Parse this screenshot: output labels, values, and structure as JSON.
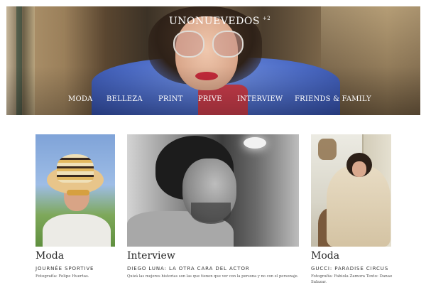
{
  "header": {
    "brand": "UNONUEVEDOS",
    "brand_suffix": "+2",
    "nav": [
      "MODA",
      "BELLEZA",
      "PRINT",
      "PRIVE",
      "INTERVIEW",
      "FRIENDS & FAMILY"
    ]
  },
  "cards": [
    {
      "category": "Moda",
      "title": "JOURNÉE SPORTIVE",
      "description": "Fotografía: Felipe Huertas."
    },
    {
      "category": "Interview",
      "title": "DIEGO LUNA: LA OTRA CARA DEL ACTOR",
      "description": "Quizá las mejores historias son las que tienen que ver con la persona y no con el personaje."
    },
    {
      "category": "Moda",
      "title": "GUCCI: PARADISE CIRCUS",
      "description": "Fotografía: Fabiola Zamora Texto: Danae Salazar."
    }
  ],
  "colors": {
    "nav_text": "#ffffff",
    "heading_text": "#2a2a2a",
    "body_text": "#555555"
  }
}
